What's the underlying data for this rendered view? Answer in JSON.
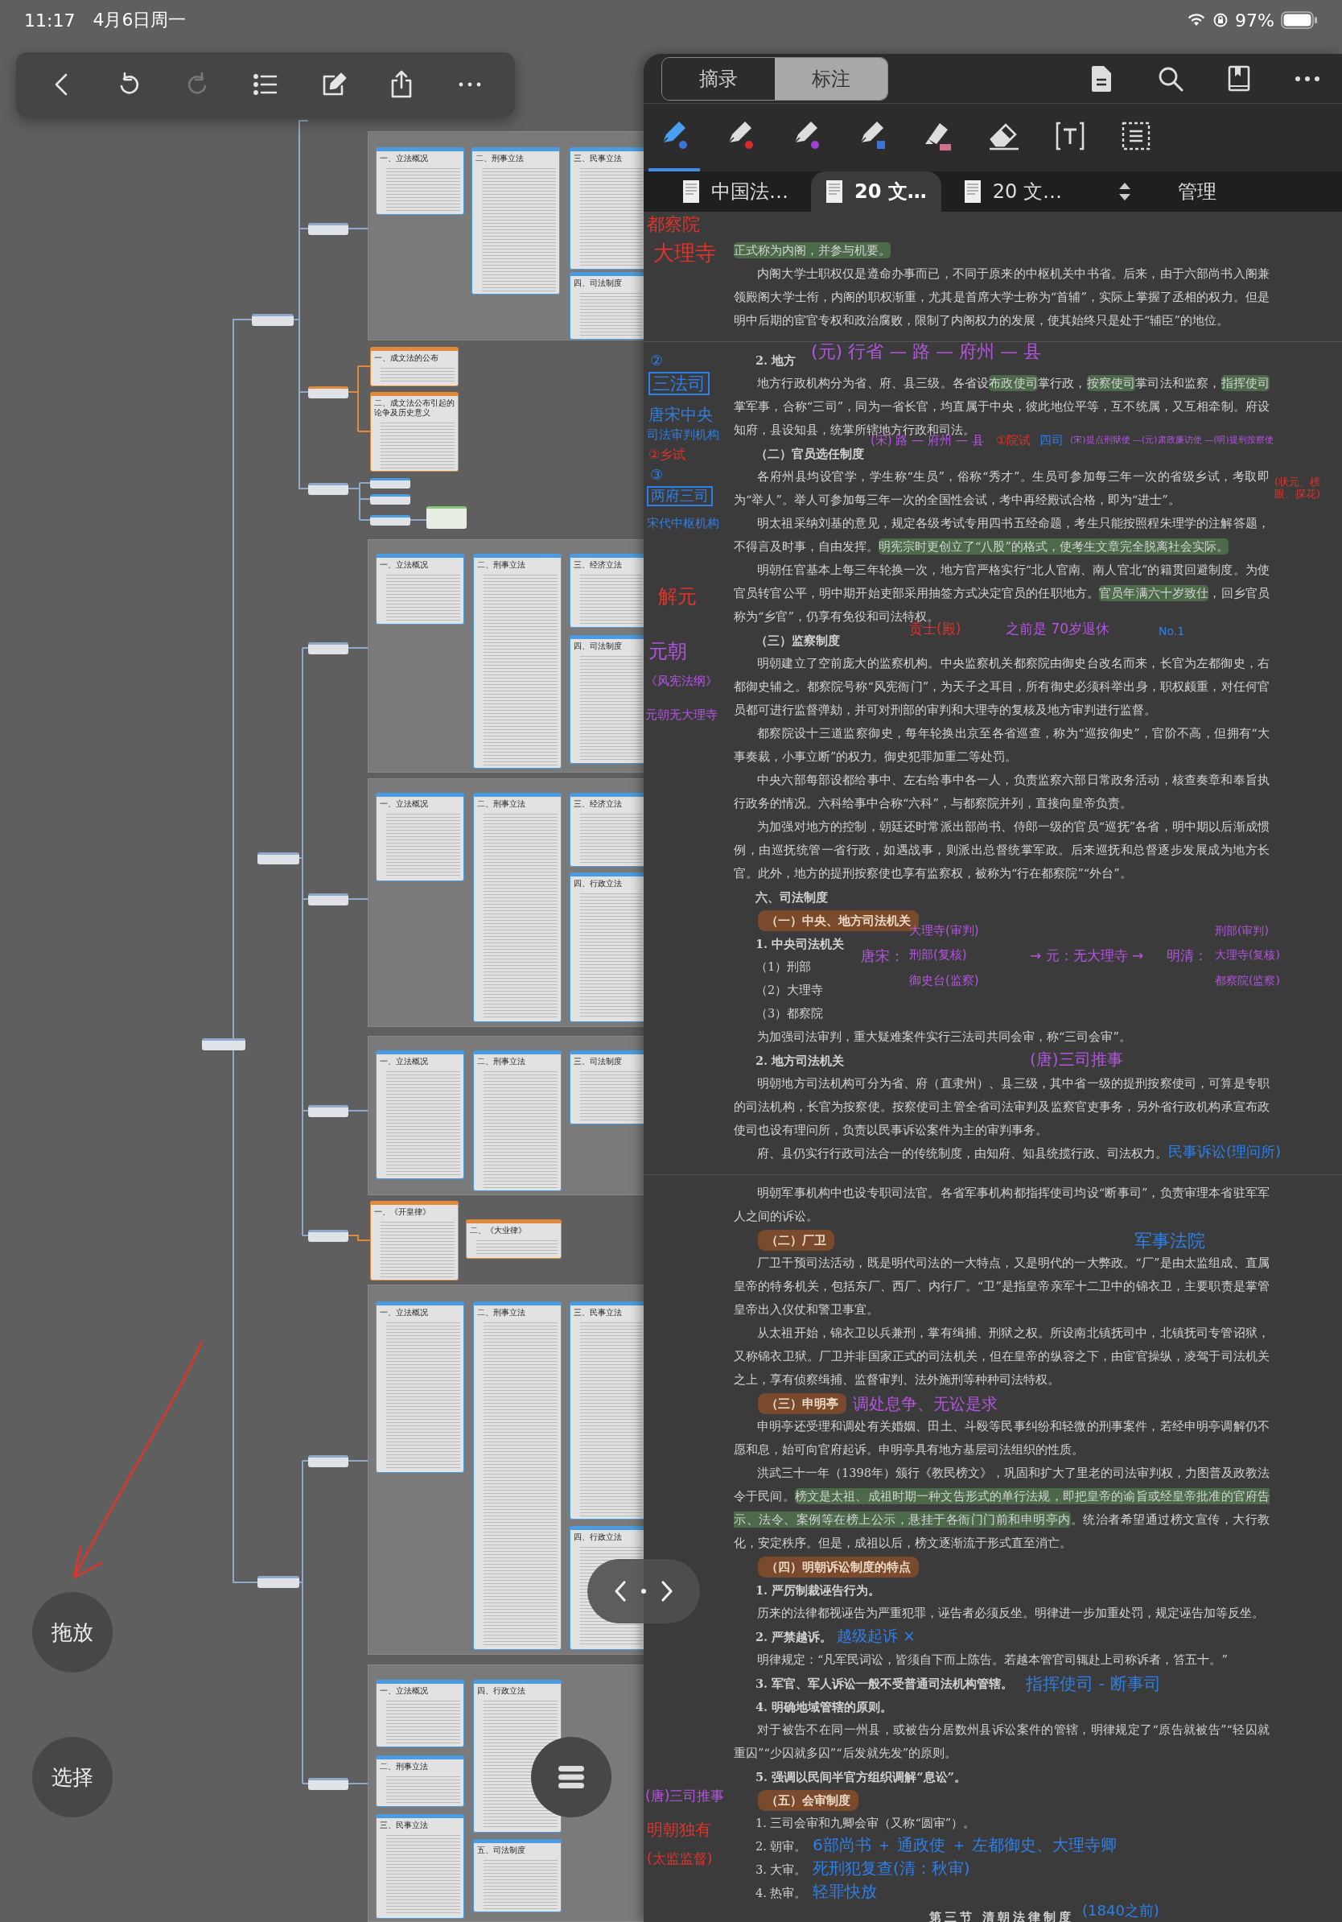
{
  "status_bar": {
    "time": "11:17",
    "date": "4月6日周一",
    "battery": "97%"
  },
  "toolbar": [
    {
      "kind": "back",
      "disabled": false
    },
    {
      "kind": "undo",
      "disabled": false
    },
    {
      "kind": "redo",
      "disabled": true
    },
    {
      "kind": "outline",
      "disabled": false
    },
    {
      "kind": "edit",
      "disabled": false
    },
    {
      "kind": "share",
      "disabled": false
    },
    {
      "kind": "more",
      "disabled": false
    }
  ],
  "mindmap": {
    "groups": [
      {
        "panel": true,
        "color": "#4a9be0",
        "cards": [
          {
            "title": "一、立法概况"
          },
          {
            "title": "二、刑事立法"
          },
          {
            "title": "三、民事立法"
          },
          {
            "title": "四、司法制度"
          }
        ]
      },
      {
        "panel": false,
        "color": "#e08a3a",
        "cards": [
          {
            "title": "一、成文法的公布"
          },
          {
            "title": "二、成文法公布引起的论争及历史意义"
          }
        ]
      },
      {
        "panel": true,
        "color": "#4a9be0",
        "cards": [
          {
            "title": "一、立法概况"
          },
          {
            "title": "二、刑事立法"
          },
          {
            "title": "三、经济立法"
          },
          {
            "title": "四、司法制度"
          }
        ]
      },
      {
        "panel": true,
        "color": "#4a9be0",
        "cards": [
          {
            "title": "一、立法概况"
          },
          {
            "title": "二、刑事立法"
          },
          {
            "title": "三、经济立法"
          },
          {
            "title": "四、行政立法"
          }
        ]
      },
      {
        "panel": true,
        "color": "#4a9be0",
        "cards": [
          {
            "title": "一、立法概况"
          },
          {
            "title": "二、刑事立法"
          },
          {
            "title": "三、司法制度"
          }
        ]
      },
      {
        "panel": false,
        "color": "#e08a3a",
        "cards": [
          {
            "title": "一、《开皇律》"
          },
          {
            "title": "二、《大业律》"
          }
        ]
      },
      {
        "panel": true,
        "color": "#4a9be0",
        "cards": [
          {
            "title": "一、立法概况"
          },
          {
            "title": "二、刑事立法"
          },
          {
            "title": "三、民事立法"
          },
          {
            "title": "四、行政立法"
          }
        ]
      },
      {
        "panel": true,
        "color": "#4a9be0",
        "cards": [
          {
            "title": "一、立法概况"
          },
          {
            "title": "四、行政立法"
          },
          {
            "title": "二、刑事立法"
          },
          {
            "title": "三、民事立法"
          },
          {
            "title": "五、司法制度"
          }
        ]
      }
    ]
  },
  "side_buttons": [
    "拖放",
    "选择"
  ],
  "panel": {
    "modes": [
      {
        "label": "摘录",
        "selected": false
      },
      {
        "label": "标注",
        "selected": true
      }
    ],
    "tools": [
      {
        "kind": "pen",
        "color": "#3b74d9",
        "selected": true
      },
      {
        "kind": "pen",
        "color": "#d62b2b",
        "selected": false
      },
      {
        "kind": "pen",
        "color": "#a03fd6",
        "selected": false
      },
      {
        "kind": "marker",
        "color": "#3b74d9",
        "selected": false
      },
      {
        "kind": "highlighter",
        "color": "#d2708c",
        "selected": false
      },
      {
        "kind": "eraser",
        "selected": false
      },
      {
        "kind": "text",
        "selected": false
      },
      {
        "kind": "select",
        "selected": false
      }
    ],
    "tabs": [
      {
        "label": "中国法…",
        "selected": false
      },
      {
        "label": "20 文…",
        "selected": true
      },
      {
        "label": "20 文…",
        "selected": false
      }
    ],
    "manage": "管理"
  },
  "document": [
    {
      "kind": "cont",
      "segments": [
        {
          "text": "正式称为内阁，并参与机要。",
          "highlight": true
        }
      ]
    },
    {
      "kind": "para",
      "text": "内阁大学士职权仅是遵命办事而已，不同于原来的中枢机关中书省。后来，由于六部尚书入阁兼领殿阁大学士衔，内阁的职权渐重，尤其是首席大学士称为“首辅”，实际上掌握了丞相的权力。但是明中后期的宦官专权和政治腐败，限制了内阁权力的发展，使其始终只是处于“辅臣”的地位。"
    },
    {
      "kind": "page_break"
    },
    {
      "kind": "heading",
      "text": "2. 地方"
    },
    {
      "kind": "para",
      "segments": [
        {
          "text": "地方行政机构分为省、府、县三级。各省设",
          "highlight": false
        },
        {
          "text": "布政使司",
          "highlight": true
        },
        {
          "text": "掌行政，",
          "highlight": false
        },
        {
          "text": "按察使司",
          "highlight": true
        },
        {
          "text": "掌司法和监察，",
          "highlight": false
        },
        {
          "text": "指挥使司",
          "highlight": true
        },
        {
          "text": "掌军事，合称“三司”，同为一省长官，均直属于中央，彼此地位平等，互不统属，又互相牵制。府设知府，县设知县，统掌所辖地方行政和司法。",
          "highlight": false
        }
      ]
    },
    {
      "kind": "heading",
      "text": "（二）官员选任制度"
    },
    {
      "kind": "para",
      "text": "各府州县均设官学，学生称“生员”，俗称“秀才”。生员可参加每三年一次的省级乡试，考取即为“举人”。举人可参加每三年一次的全国性会试，考中再经殿试合格，即为“进士”。"
    },
    {
      "kind": "para",
      "segments": [
        {
          "text": "明太祖采纳刘基的意见，规定各级考试专用四书五经命题，考生只能按照程朱理学的注解答题，不得言及时事，自由发挥。",
          "highlight": false
        },
        {
          "text": "明宪宗时更创立了“八股”的格式，使考生文章完全脱离社会实际。",
          "highlight": true
        }
      ]
    },
    {
      "kind": "para",
      "segments": [
        {
          "text": "明朝任官基本上每三年轮换一次，地方官严格实行“北人官南、南人官北”的籍贯回避制度。为使官员转官公平，明中期开始吏部采用抽签方式决定官员的任职地方。",
          "highlight": false
        },
        {
          "text": "官员年满六十岁致仕",
          "highlight": true
        },
        {
          "text": "，回乡官员称为“乡官”，仍享有免役和司法特权。",
          "highlight": false
        }
      ]
    },
    {
      "kind": "heading",
      "text": "（三）监察制度"
    },
    {
      "kind": "para",
      "text": "明朝建立了空前庞大的监察机构。中央监察机关都察院由御史台改名而来，长官为左都御史，右都御史辅之。都察院号称“风宪衙门”，为天子之耳目，所有御史必须科举出身，职权颇重，对任何官员都可进行监督弹劾，并可对刑部的审判和大理寺的复核及地方审判进行监督。"
    },
    {
      "kind": "para",
      "text": "都察院设十三道监察御史，每年轮换出京至各省巡查，称为“巡按御史”，官阶不高，但拥有“大事奏裁，小事立断”的权力。御史犯罪加重二等处罚。"
    },
    {
      "kind": "para",
      "text": "中央六部每部设都给事中、左右给事中各一人，负责监察六部日常政务活动，核查奏章和奉旨执行政务的情况。六科给事中合称“六科”，与都察院并列，直接向皇帝负责。"
    },
    {
      "kind": "para",
      "text": "为加强对地方的控制，朝廷还时常派出部尚书、侍郎一级的官员“巡抚”各省，明中期以后渐成惯例，由巡抚统管一省行政，如遇战事，则派出总督统掌军政。后来巡抚和总督逐步发展成为地方长官。此外，地方的提刑按察使也享有监察权，被称为“行在都察院”“外台”。"
    },
    {
      "kind": "heading",
      "text": "六、司法制度"
    },
    {
      "kind": "tag",
      "text": "（一）中央、地方司法机关"
    },
    {
      "kind": "heading",
      "text": "1. 中央司法机关"
    },
    {
      "kind": "item",
      "text": "（1）刑部"
    },
    {
      "kind": "item",
      "text": "（2）大理寺"
    },
    {
      "kind": "item",
      "text": "（3）都察院"
    },
    {
      "kind": "para",
      "text": "为加强司法审判，重大疑难案件实行三法司共同会审，称“三司会审”。"
    },
    {
      "kind": "heading",
      "text": "2. 地方司法机关"
    },
    {
      "kind": "para",
      "text": "明朝地方司法机构可分为省、府（直隶州）、县三级，其中省一级的提刑按察使司，可算是专职的司法机构，长官为按察使。按察使司主管全省司法审判及监察官吏事务，另外省行政机构承宣布政使司也设有理问所，负责以民事诉讼案件为主的审判事务。"
    },
    {
      "kind": "para",
      "text": "府、县仍实行行政司法合一的传统制度，由知府、知县统揽行政、司法权力。"
    },
    {
      "kind": "page_break"
    },
    {
      "kind": "para",
      "text": "明朝军事机构中也设专职司法官。各省军事机构都指挥使司均设“断事司”，负责审理本省驻军军人之间的诉讼。"
    },
    {
      "kind": "tag",
      "text": "（二）厂卫"
    },
    {
      "kind": "para",
      "text": "厂卫干预司法活动，既是明代司法的一大特点，又是明代的一大弊政。“厂”是由太监组成、直属皇帝的特务机关，包括东厂、西厂、内行厂。“卫”是指皇帝亲军十二卫中的锦衣卫，主要职责是掌管皇帝出入仪仗和警卫事宜。"
    },
    {
      "kind": "para",
      "text": "从太祖开始，锦衣卫以兵兼刑，掌有缉捕、刑狱之权。所设南北镇抚司中，北镇抚司专管诏狱，又称锦衣卫狱。厂卫并非国家正式的司法机关，但在皇帝的纵容之下，由宦官操纵，凌驾于司法机关之上，享有侦察缉捕、监督审判、法外施刑等种种司法特权。"
    },
    {
      "kind": "tag",
      "text": "（三）申明亭"
    },
    {
      "kind": "para",
      "text": "申明亭还受理和调处有关婚姻、田土、斗殴等民事纠纷和轻微的刑事案件，若经申明亭调解仍不愿和息，始可向官府起诉。申明亭具有地方基层司法组织的性质。"
    },
    {
      "kind": "para",
      "segments": [
        {
          "text": "洪武三十一年（1398年）颁行《教民榜文》，巩固和扩大了里老的司法审判权，力图普及政教法令于民间。",
          "highlight": false
        },
        {
          "text": "榜文是太祖、成祖时期一种文告形式的单行法规，即把皇帝的谕旨或经皇帝批准的官府告示、法令、案例等在榜上公示，悬挂于各衙门门前和申明亭内",
          "highlight": true
        },
        {
          "text": "。统治者希望通过榜文宣传，大行教化，安定秩序。但是，成祖以后，榜文逐渐流于形式直至消亡。",
          "highlight": false
        }
      ]
    },
    {
      "kind": "tag",
      "text": "（四）明朝诉讼制度的特点"
    },
    {
      "kind": "heading",
      "text": "1. 严厉制裁诬告行为。"
    },
    {
      "kind": "para",
      "text": "历来的法律都视诬告为严重犯罪，诬告者必须反坐。明律进一步加重处罚，规定诬告加等反坐。"
    },
    {
      "kind": "heading",
      "text": "2. 严禁越诉。"
    },
    {
      "kind": "para",
      "text": "明律规定：“凡军民词讼，皆须自下而上陈告。若越本管官司辄赴上司称诉者，笞五十。”"
    },
    {
      "kind": "heading",
      "text": "3. 军官、军人诉讼一般不受普通司法机构管辖。"
    },
    {
      "kind": "heading",
      "text": "4. 明确地域管辖的原则。"
    },
    {
      "kind": "para",
      "text": "对于被告不在同一州县，或被告分居数州县诉讼案件的管辖，明律规定了“原告就被告”“轻囚就重囚”“少囚就多囚”“后发就先发”的原则。"
    },
    {
      "kind": "heading",
      "text": "5. 强调以民间半官方组织调解“息讼”。"
    },
    {
      "kind": "tag",
      "text": "（五）会审制度"
    },
    {
      "kind": "item",
      "text": "1. 三司会审和九卿会审（又称“圆审”）。"
    },
    {
      "kind": "item",
      "text": "2. 朝审。"
    },
    {
      "kind": "item",
      "text": "3. 大审。"
    },
    {
      "kind": "item",
      "text": "4. 热审。"
    },
    {
      "kind": "title",
      "text": "第三节 清朝法律制度"
    }
  ],
  "ink_notes": [
    {
      "text": "都察院",
      "color": "#e0332b"
    },
    {
      "text": "大理寺",
      "color": "#e0332b"
    },
    {
      "text": "②",
      "color": "#2f7fe8"
    },
    {
      "text": "三法司",
      "color": "#2f7fe8"
    },
    {
      "text": "唐宋中央",
      "color": "#2f7fe8"
    },
    {
      "text": "司法审判机构",
      "color": "#2f7fe8"
    },
    {
      "text": "②乡试",
      "color": "#e0332b"
    },
    {
      "text": "③",
      "color": "#2f7fe8"
    },
    {
      "text": "两府三司",
      "color": "#2f7fe8"
    },
    {
      "text": "宋代中枢机构",
      "color": "#2f7fe8"
    },
    {
      "text": "解元",
      "color": "#e0332b"
    },
    {
      "text": "元朝",
      "color": "#b455e0"
    },
    {
      "text": "《风宪法纲》",
      "color": "#b455e0"
    },
    {
      "text": "元朝无大理寺",
      "color": "#b455e0"
    },
    {
      "text": "(元) 行省 — 路 — 府州 — 县",
      "color": "#b455e0"
    },
    {
      "text": "(宋) 路 — 府州 — 县",
      "color": "#b455e0"
    },
    {
      "text": "①院试",
      "color": "#e0332b"
    },
    {
      "text": "四司",
      "color": "#2f7fe8"
    },
    {
      "text": "(宋)提点刑狱使 —(元)肃政廉访使 —(明)提刑按察使",
      "color": "#b455e0"
    },
    {
      "text": "(状元、榜眼、探花)",
      "color": "#e0332b"
    },
    {
      "text": "贡士(殿)",
      "color": "#e0332b"
    },
    {
      "text": "之前是 70岁退休",
      "color": "#b455e0"
    },
    {
      "text": "No.1",
      "color": "#2f7fe8"
    },
    {
      "text": "唐宋：",
      "color": "#b455e0"
    },
    {
      "text": "大理寺(审判)",
      "color": "#b455e0"
    },
    {
      "text": "刑部(复核)",
      "color": "#b455e0"
    },
    {
      "text": "御史台(监察)",
      "color": "#b455e0"
    },
    {
      "text": "→ 元：无大理寺 →",
      "color": "#b455e0"
    },
    {
      "text": "明清：",
      "color": "#b455e0"
    },
    {
      "text": "刑部(审判)",
      "color": "#b455e0"
    },
    {
      "text": "大理寺(复核)",
      "color": "#b455e0"
    },
    {
      "text": "都察院(监察)",
      "color": "#b455e0"
    },
    {
      "text": "(唐)三司推事",
      "color": "#b455e0"
    },
    {
      "text": "民事诉讼(理问所)",
      "color": "#2f7fe8"
    },
    {
      "text": "军事法院",
      "color": "#2f7fe8"
    },
    {
      "text": "调处息争、无讼是求",
      "color": "#b455e0"
    },
    {
      "text": "越级起诉 ×",
      "color": "#2f7fe8"
    },
    {
      "text": "指挥使司 - 断事司",
      "color": "#2f7fe8"
    },
    {
      "text": "(唐)三司推事",
      "color": "#b455e0"
    },
    {
      "text": "6部尚书 ＋ 通政使 ＋ 左都御史、大理寺卿",
      "color": "#2f7fe8"
    },
    {
      "text": "死刑犯复查(清：秋审)",
      "color": "#2f7fe8"
    },
    {
      "text": "明朝独有",
      "color": "#e0332b"
    },
    {
      "text": "(太监监督)",
      "color": "#e0332b"
    },
    {
      "text": "轻罪快放",
      "color": "#2f7fe8"
    },
    {
      "text": "(1840之前)",
      "color": "#2f7fe8"
    }
  ]
}
